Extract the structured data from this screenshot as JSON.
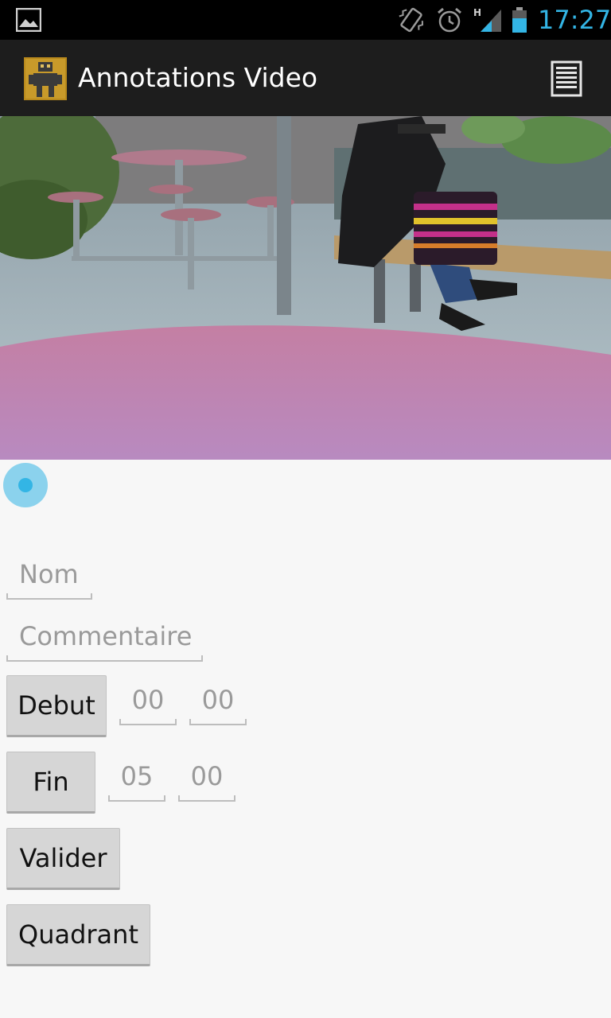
{
  "status_bar": {
    "time": "17:27",
    "icons": [
      "image-notification-icon",
      "vibrate-icon",
      "alarm-icon",
      "signal-h-icon",
      "battery-icon"
    ]
  },
  "action_bar": {
    "title": "Annotations Video",
    "menu_icon": "overflow-menu-icon"
  },
  "video": {
    "seek_progress": 0
  },
  "form": {
    "nom_placeholder": "Nom",
    "commentaire_placeholder": "Commentaire",
    "debut_button": "Debut",
    "debut_minutes": "00",
    "debut_seconds": "00",
    "fin_button": "Fin",
    "fin_minutes": "05",
    "fin_seconds": "00",
    "valider_button": "Valider",
    "quadrant_button": "Quadrant"
  },
  "colors": {
    "accent": "#33b5e5",
    "action_bar": "#1d1d1d",
    "background": "#f7f7f7",
    "button": "#d6d6d6"
  }
}
